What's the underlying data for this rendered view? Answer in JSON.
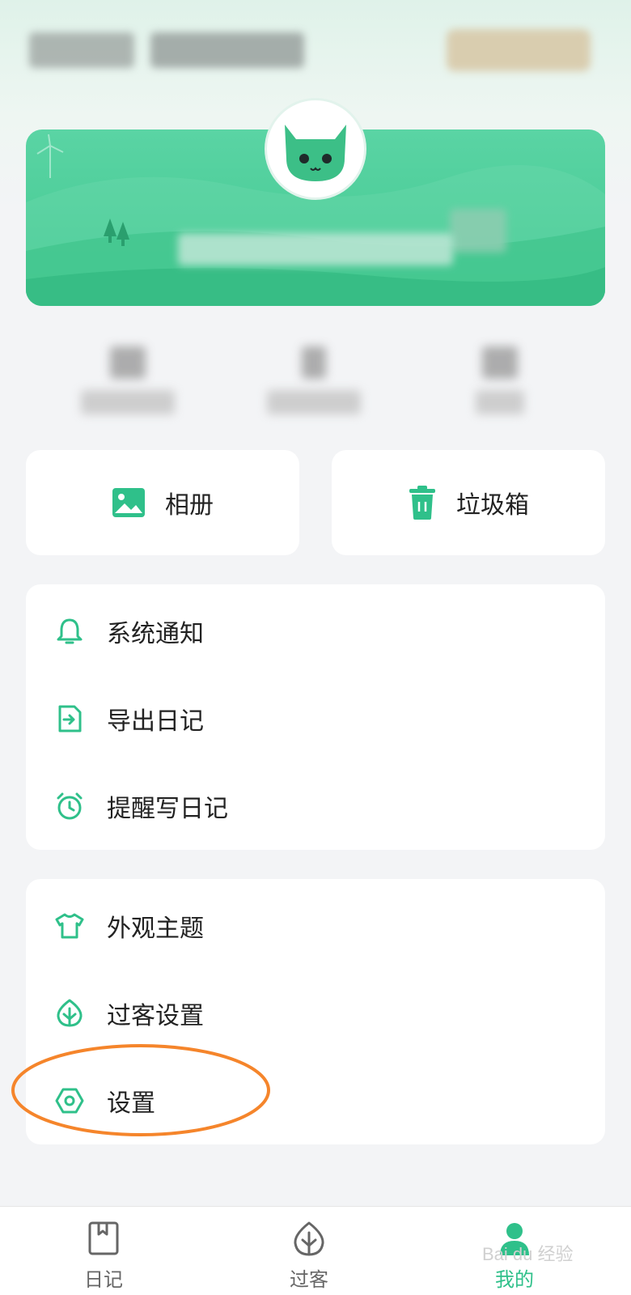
{
  "colors": {
    "accent": "#2fc08a",
    "banner": "#4acd98",
    "background": "#f3f4f6",
    "highlight": "#f5852b"
  },
  "quick_actions": [
    {
      "label": "相册",
      "icon": "photo-album-icon"
    },
    {
      "label": "垃圾箱",
      "icon": "trash-icon"
    }
  ],
  "menu_group_1": [
    {
      "label": "系统通知",
      "icon": "bell-icon"
    },
    {
      "label": "导出日记",
      "icon": "export-file-icon"
    },
    {
      "label": "提醒写日记",
      "icon": "alarm-clock-icon"
    }
  ],
  "menu_group_2": [
    {
      "label": "外观主题",
      "icon": "tshirt-icon"
    },
    {
      "label": "过客设置",
      "icon": "leaf-icon"
    },
    {
      "label": "设置",
      "icon": "settings-hexagon-icon"
    }
  ],
  "bottom_nav": [
    {
      "label": "日记",
      "icon": "diary-bookmark-icon",
      "active": false
    },
    {
      "label": "过客",
      "icon": "leaf-icon",
      "active": false
    },
    {
      "label": "我的",
      "icon": "user-icon",
      "active": true
    }
  ],
  "watermark": "Bai du 经验"
}
